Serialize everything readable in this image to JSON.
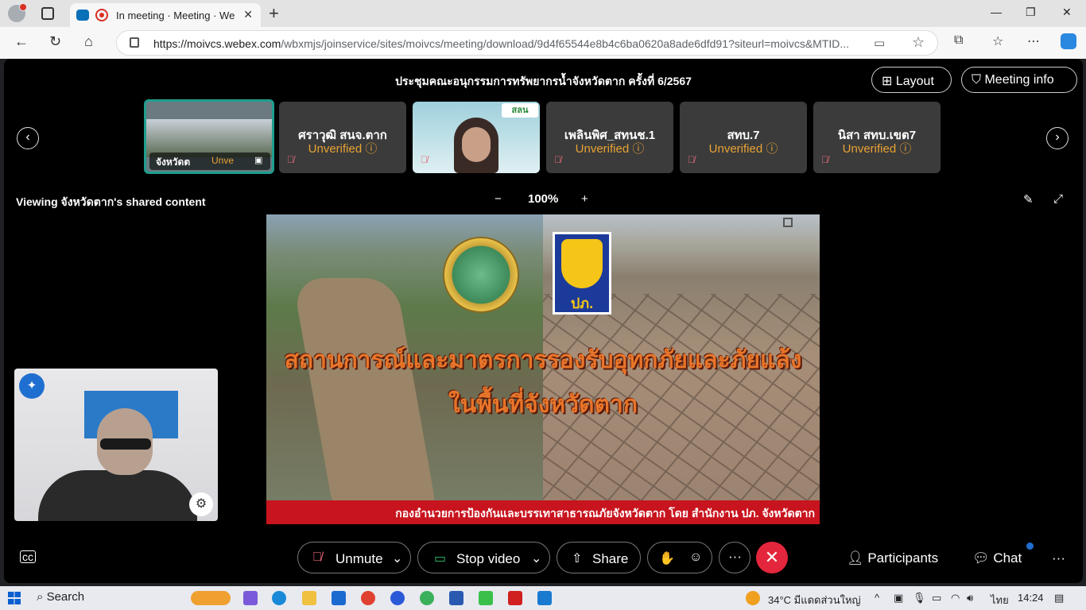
{
  "browser": {
    "tab_title": "In meeting · Meeting · Webe",
    "tab_close": "✕",
    "new_tab": "+",
    "url_host": "https://moivcs.webex.com",
    "url_path": "/wbxmjs/joinservice/sites/moivcs/meeting/download/9d4f65544e8b4c6ba0620a8ade6dfd91?siteurl=moivcs&MTID...",
    "window_controls": [
      "—",
      "❐",
      "✕"
    ]
  },
  "meeting": {
    "title": "ประชุมคณะอนุกรรมการทรัพยากรน้ำจังหวัดตาก ครั้งที่ 6/2567",
    "layout_label": "Layout",
    "info_label": "Meeting info",
    "viewing_text": "Viewing จังหวัดตาก's shared content",
    "zoom_minus": "−",
    "zoom_level": "100%",
    "zoom_plus": "+"
  },
  "participants": [
    {
      "name": "จังหวัดต",
      "status": "Unve",
      "active": true
    },
    {
      "name": "ศราวุฒิ สนจ.ตาก",
      "status": "Unverified ⓘ"
    },
    {
      "name": "",
      "status": "",
      "video": true,
      "logo_text": "สลน"
    },
    {
      "name": "เพลินพิศ_สทนช.1",
      "status": "Unverified ⓘ"
    },
    {
      "name": "สทบ.7",
      "status": "Unverified ⓘ"
    },
    {
      "name": "นิสา สทบ.เขต7",
      "status": "Unverified ⓘ"
    }
  ],
  "slide": {
    "line1": "สถานการณ์และมาตรการรองรับอุทกภัยและภัยแล้ง",
    "line2": "ในพื้นที่จังหวัดตาก",
    "footer": "กองอำนวยการป้องกันและบรรเทาสาธารณภัยจังหวัดตาก โดย สำนักงาน ปภ. จังหวัดตาก",
    "logo_text": "ปภ."
  },
  "controls": {
    "unmute": "Unmute",
    "stop_video": "Stop video",
    "share": "Share",
    "participants": "Participants",
    "chat": "Chat",
    "more": "···",
    "leave": "✕"
  },
  "taskbar": {
    "search": "Search",
    "weather": "34°C มีแดดส่วนใหญ่",
    "lang": "ไทย",
    "time": "14:24"
  }
}
